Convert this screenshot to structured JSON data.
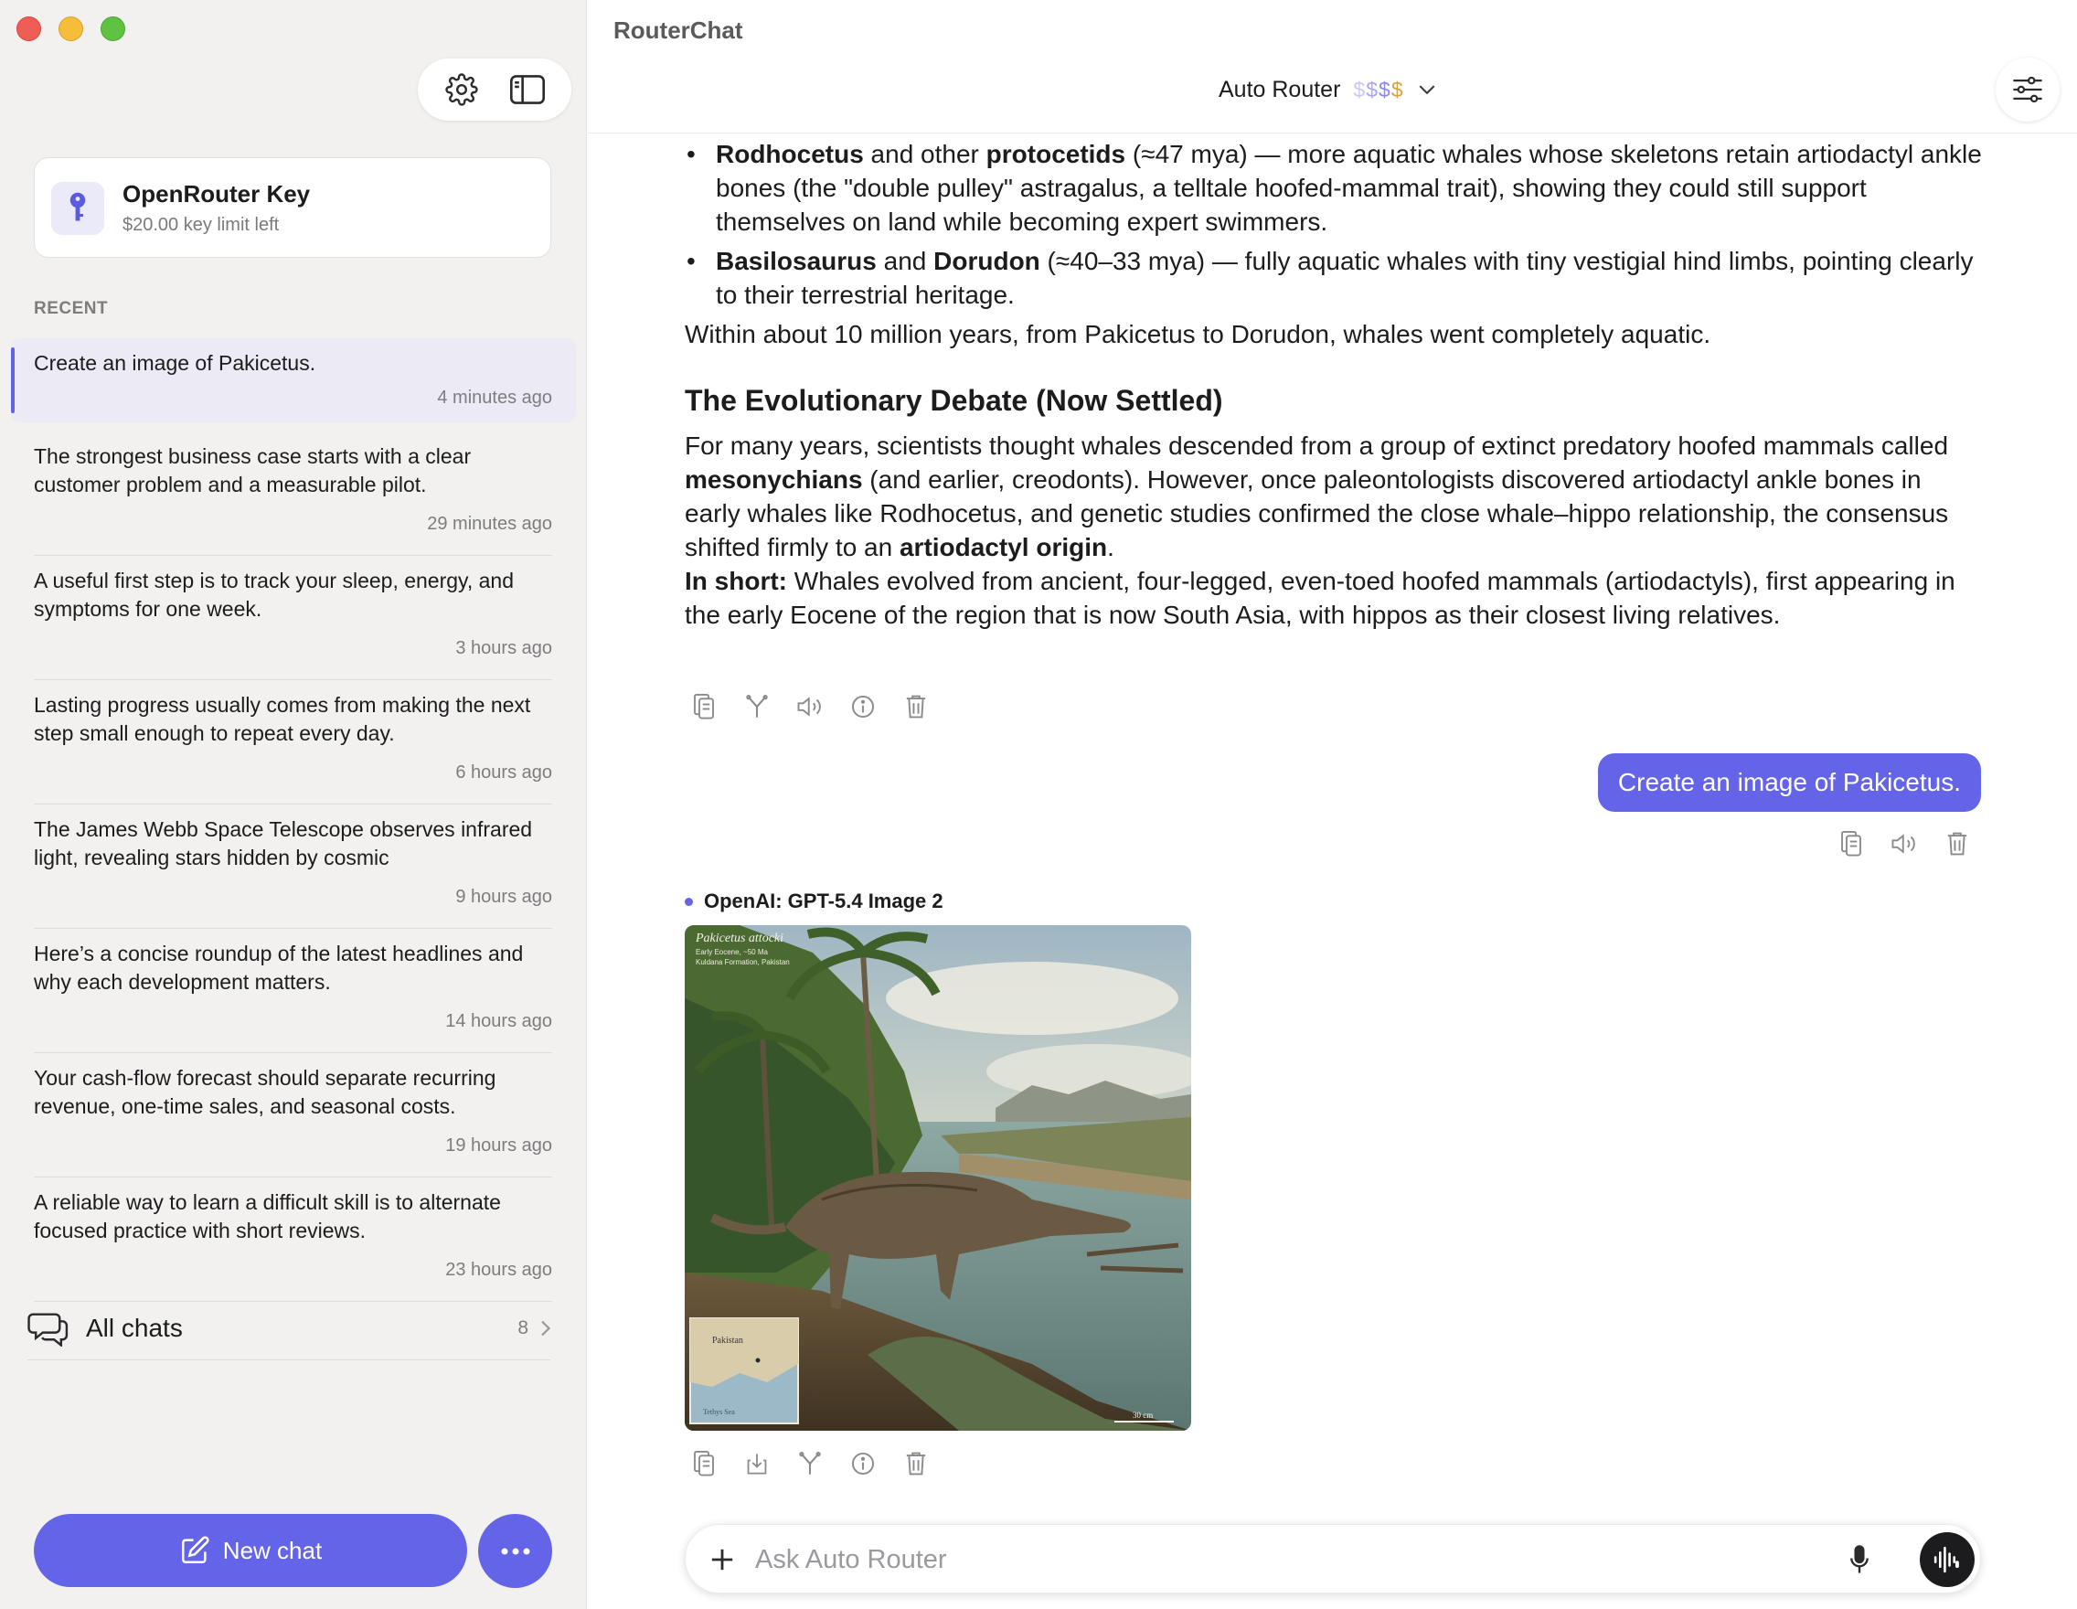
{
  "app": {
    "title": "RouterChat"
  },
  "sidebar": {
    "key_card": {
      "title": "OpenRouter Key",
      "subtitle": "$20.00 key limit left"
    },
    "recent_label": "RECENT",
    "chats": [
      {
        "text": "Create an image of Pakicetus.",
        "time": "4 minutes ago",
        "active": true
      },
      {
        "text": "The strongest business case starts with a clear customer problem and a measurable pilot.",
        "time": "29 minutes ago"
      },
      {
        "text": "A useful first step is to track your sleep, energy, and symptoms for one week.",
        "time": "3 hours ago"
      },
      {
        "text": "Lasting progress usually comes from making the next step small enough to repeat every day.",
        "time": "6 hours ago"
      },
      {
        "text": "The James Webb Space Telescope observes infrared light, revealing stars hidden by cosmic",
        "time": "9 hours ago"
      },
      {
        "text": "Here’s a concise roundup of the latest headlines and why each development matters.",
        "time": "14 hours ago"
      },
      {
        "text": "Your cash-flow forecast should separate recurring revenue, one-time sales, and seasonal costs.",
        "time": "19 hours ago"
      },
      {
        "text": "A reliable way to learn a difficult skill is to alternate focused practice with short reviews.",
        "time": "23 hours ago"
      }
    ],
    "all_chats": {
      "label": "All chats",
      "count": "8"
    },
    "new_chat_label": "New chat"
  },
  "header": {
    "model_name": "Auto Router",
    "price_symbols": [
      "$",
      "$",
      "$",
      "$"
    ]
  },
  "message": {
    "bullets": [
      {
        "parts": [
          {
            "t": "Rodhocetus",
            "b": true
          },
          {
            "t": " and other "
          },
          {
            "t": "protocetids",
            "b": true
          },
          {
            "t": " (≈47 mya) — more aquatic whales whose skeletons retain artiodactyl ankle bones (the \"double pulley\" astragalus, a telltale hoofed-mammal trait), showing they could still support themselves on land while becoming expert swimmers."
          }
        ]
      },
      {
        "parts": [
          {
            "t": "Basilosaurus",
            "b": true
          },
          {
            "t": " and "
          },
          {
            "t": "Dorudon",
            "b": true
          },
          {
            "t": " (≈40–33 mya) — fully aquatic whales with tiny vestigial hind limbs, pointing clearly to their terrestrial heritage."
          }
        ]
      }
    ],
    "summary_line": "Within about 10 million years, from Pakicetus to Dorudon, whales went completely aquatic.",
    "section_heading": "The Evolutionary Debate (Now Settled)",
    "debate_paragraph": [
      {
        "t": "For many years, scientists thought whales descended from a group of extinct predatory hoofed mammals called "
      },
      {
        "t": "mesonychians",
        "b": true
      },
      {
        "t": " (and earlier, creodonts). However, once paleontologists discovered artiodactyl ankle bones in early whales like Rodhocetus, and genetic studies confirmed the close whale–hippo relationship, the consensus shifted firmly to an "
      },
      {
        "t": "artiodactyl origin",
        "b": true
      },
      {
        "t": "."
      }
    ],
    "in_short": [
      {
        "t": "In short:",
        "b": true
      },
      {
        "t": " Whales evolved from ancient, four-legged, even-toed hoofed mammals (artiodactyls), first appearing in the early Eocene of the region that is now South Asia, with hippos as their closest living relatives."
      }
    ]
  },
  "user_message": {
    "text": "Create an image of Pakicetus."
  },
  "response": {
    "model_label": "OpenAI: GPT-5.4 Image 2",
    "image": {
      "caption_title": "Pakicetus attocki",
      "caption_line1": "Early Eocene, ~50 Ma",
      "caption_line2": "Kuldana Formation, Pakistan",
      "map_label": "Pakistan",
      "map_sea": "Tethys Sea",
      "scale": "30 cm"
    }
  },
  "composer": {
    "placeholder": "Ask Auto Router"
  },
  "colors": {
    "accent": "#6464e8",
    "sidebar_bg": "#f2f1ef"
  }
}
